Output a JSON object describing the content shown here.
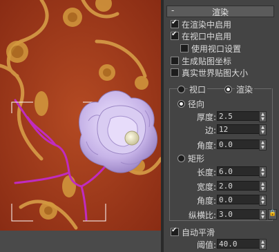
{
  "colors": {
    "panel_bg": "#444444",
    "viewport_bg": "#a23a1c",
    "path_color": "#c02bc0",
    "rose_color": "#c9b7e8",
    "selection_bracket": "#ffffff"
  },
  "viewport": {
    "label": "viewport",
    "bracket_color": "#ffffff"
  },
  "rollout": {
    "collapse_symbol": "-",
    "title": "渲染"
  },
  "checkboxes": {
    "enable_in_renderer": {
      "label": "在渲染中启用",
      "checked": true
    },
    "enable_in_viewport": {
      "label": "在视口中启用",
      "checked": true
    },
    "use_viewport_settings": {
      "label": "使用视口设置",
      "checked": false
    },
    "generate_mapping_coords": {
      "label": "生成贴图坐标",
      "checked": false
    },
    "real_world_map_size": {
      "label": "真实世界贴图大小",
      "checked": false
    }
  },
  "mode": {
    "viewport_label": "视口",
    "render_label": "渲染",
    "selected": "渲染"
  },
  "radial": {
    "label": "径向",
    "selected": true,
    "thickness_label": "厚度:",
    "thickness_value": "2.5",
    "sides_label": "边:",
    "sides_value": "12",
    "angle_label": "角度:",
    "angle_value": "0.0"
  },
  "rectangular": {
    "label": "矩形",
    "selected": false,
    "length_label": "长度:",
    "length_value": "6.0",
    "width_label": "宽度:",
    "width_value": "2.0",
    "angle_label": "角度:",
    "angle_value": "0.0",
    "aspect_label": "纵横比:",
    "aspect_value": "3.0"
  },
  "auto_smooth": {
    "label": "自动平滑",
    "checked": true,
    "threshold_label": "阈值:",
    "threshold_value": "40.0"
  },
  "icons": {
    "lock": "lock-icon",
    "spinner": "spinner-arrows-icon"
  }
}
